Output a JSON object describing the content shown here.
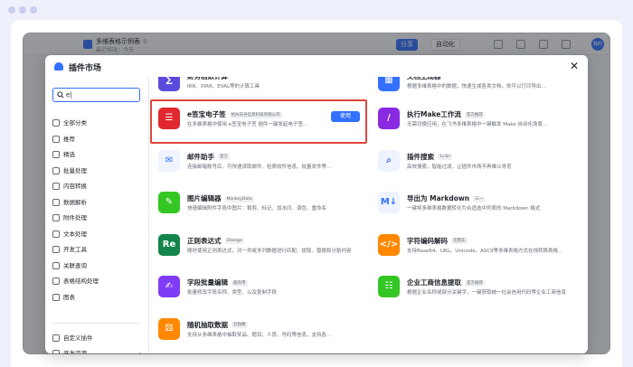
{
  "app": {
    "doc_title": "多维表格示例表 ☆",
    "doc_subtitle": "最近修改：今天",
    "share_label": "分享",
    "automation_label": "自动化",
    "avatar_text": "我的"
  },
  "modal": {
    "title": "插件市场",
    "close": "✕"
  },
  "search": {
    "value": "e|",
    "placeholder": ""
  },
  "sidebar": {
    "items": [
      {
        "label": "全部分类"
      },
      {
        "label": "推荐"
      },
      {
        "label": "精选"
      },
      {
        "label": "批量处理"
      },
      {
        "label": "内容转换"
      },
      {
        "label": "数据解析"
      },
      {
        "label": "附件处理"
      },
      {
        "label": "文本处理"
      },
      {
        "label": "开发工具"
      },
      {
        "label": "关联查询"
      },
      {
        "label": "表格结构处理"
      },
      {
        "label": "图表"
      }
    ],
    "footer": [
      {
        "label": "自定义插件"
      },
      {
        "label": "开发资源",
        "chevron": "›"
      }
    ]
  },
  "cards": [
    {
      "name": "财务函数计算",
      "tag": "",
      "desc": "IRR、XIRR、EVAL等的计算工具",
      "icon": "∑",
      "color": "#5b4bdb"
    },
    {
      "name": "文档生成器",
      "tag": "",
      "desc": "根据多维表格中的数据，快速生成各类文档，你可以打印导出...",
      "icon": "▦",
      "color": "#3370ff"
    },
    {
      "name": "e签宝电子签",
      "tag": "杭州天谷信息科技有限公司",
      "desc": "在多维表格中使用 e签宝电子签 插件一键发起电子签...",
      "icon": "☰",
      "color": "#e0282e",
      "button": "使用"
    },
    {
      "name": "执行Make工作流",
      "tag": "官方推荐",
      "desc": "无需切换应用，在飞书多维表格中一键触发 Make 自动化场景...",
      "icon": "/",
      "color": "#8a2be2"
    },
    {
      "name": "邮件助手",
      "tag": "官方",
      "desc": "连接邮箱账号后，可快速读取邮件、检索收件信息、批量发件等...",
      "icon": "✉",
      "color": "#eef3ff"
    },
    {
      "name": "插件搜索",
      "tag": "1cilin",
      "desc": "高效搜索，智能过滤，让插件市场不再难以寻觅",
      "icon": "⌕",
      "color": "#eef3ff"
    },
    {
      "name": "图片编辑器",
      "tag": "MonkeyData",
      "desc": "快速编辑附件字段中图片：裁剪、标记、加水印、调色、重命名",
      "icon": "✎",
      "color": "#34c724"
    },
    {
      "name": "导出为 Markdown",
      "tag": "三一",
      "desc": "一键将多维表格数据转化为合适选中列表的 Markdown 格式",
      "icon": "M↓",
      "color": "#eef3ff"
    },
    {
      "name": "正则表达式",
      "tag": "Zhenge",
      "desc": "随时使用正则表达式，对一列或多列数据进行匹配、提取、替换和分割内容",
      "icon": "Re",
      "color": "#14854b"
    },
    {
      "name": "字符编码解码",
      "tag": "云鼎实",
      "desc": "支持Base64、URL、Unicode、ASCII等多维表格方式在线转换表格...",
      "icon": "</>",
      "color": "#ff8800"
    },
    {
      "name": "字段批量编辑",
      "tag": "超有用",
      "desc": "批量修改字段名称、类型，以及复制字段",
      "icon": "✍",
      "color": "#7f3bf5"
    },
    {
      "name": "企业工商信息提取",
      "tag": "官方推荐",
      "desc": "根据企业名称或部分关键字，一键获取统一社会信用代码等企业工商信息",
      "icon": "☷",
      "color": "#34c724"
    },
    {
      "name": "随机抽取数据",
      "tag": "云独赛",
      "desc": "支持从多维表格中抽取奖品、题目、人员、号码等信息，支持各...",
      "icon": "⚄",
      "color": "#ff8800"
    }
  ]
}
